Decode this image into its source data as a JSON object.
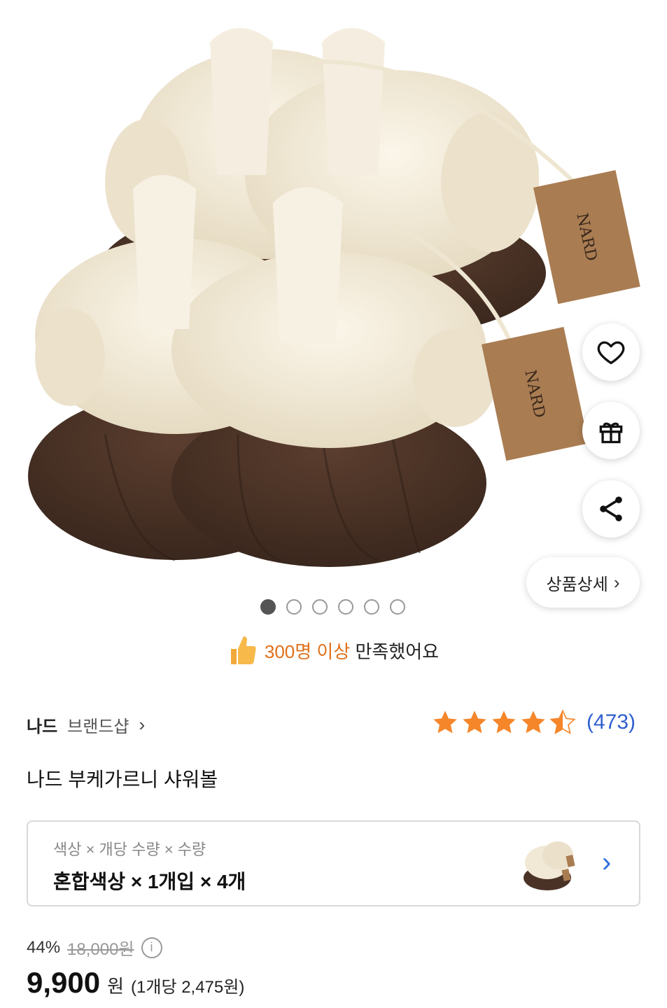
{
  "product_image": {
    "alt": "나드 부케가르니 샤워볼 product photo",
    "tag_text": "NARD"
  },
  "actions": [
    {
      "name": "wishlist",
      "icon": "heart-icon"
    },
    {
      "name": "gift",
      "icon": "gift-icon"
    },
    {
      "name": "share",
      "icon": "share-icon"
    }
  ],
  "detail_button": {
    "label": "상품상세",
    "chevron": "›"
  },
  "carousel": {
    "total": 6,
    "current": 1
  },
  "satisfaction": {
    "highlight": "300명 이상",
    "text": "만족했어요",
    "icon": "thumbs-up-icon"
  },
  "brand": {
    "name": "나드",
    "shop_label": "브랜드샵",
    "chevron": "›"
  },
  "rating": {
    "stars": 4.5,
    "count": "(473)"
  },
  "product_title": "나드 부케가르니 샤워볼",
  "option": {
    "label": "색상 × 개당 수량 × 수량",
    "value": "혼합색상 × 1개입 × 4개",
    "chevron": "›"
  },
  "price": {
    "discount": "44%",
    "original": "18,000원",
    "info_icon": "i",
    "current": "9,900",
    "currency": "원",
    "per_unit": "(1개당 2,475원)"
  },
  "colors": {
    "cream": "#f3ead8",
    "brown": "#4a3226",
    "tag": "#a97c52",
    "accent": "#e0701a",
    "link": "#2f5fd0"
  }
}
